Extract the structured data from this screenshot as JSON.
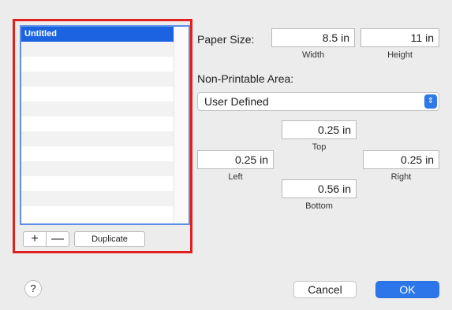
{
  "profiles": {
    "items": [
      "Untitled",
      "",
      "",
      "",
      "",
      "",
      "",
      "",
      "",
      "",
      "",
      "",
      ""
    ],
    "selected_index": 0
  },
  "list_buttons": {
    "add": "+",
    "remove": "—",
    "duplicate": "Duplicate"
  },
  "paper_size": {
    "label": "Paper Size:",
    "width_value": "8.5 in",
    "width_label": "Width",
    "height_value": "11 in",
    "height_label": "Height"
  },
  "non_printable": {
    "label": "Non-Printable Area:",
    "mode": "User Defined",
    "top_value": "0.25 in",
    "top_label": "Top",
    "left_value": "0.25 in",
    "left_label": "Left",
    "right_value": "0.25 in",
    "right_label": "Right",
    "bottom_value": "0.56 in",
    "bottom_label": "Bottom"
  },
  "footer": {
    "help": "?",
    "cancel": "Cancel",
    "ok": "OK"
  },
  "colors": {
    "highlight": "#e0201c",
    "accent": "#2c76ea"
  }
}
